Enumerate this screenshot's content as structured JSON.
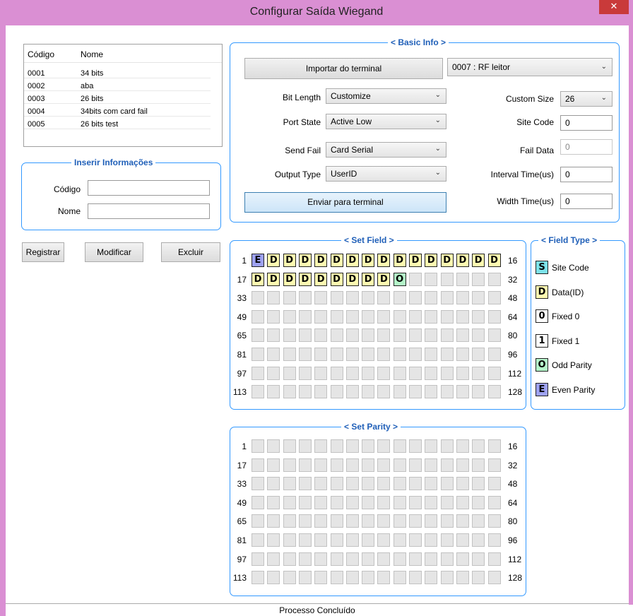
{
  "window": {
    "title": "Configurar Saída Wiegand",
    "close_glyph": "✕"
  },
  "list": {
    "columns": [
      "Código",
      "Nome"
    ],
    "rows": [
      {
        "code": "0001",
        "name": "34 bits"
      },
      {
        "code": "0002",
        "name": "aba"
      },
      {
        "code": "0003",
        "name": "26 bits"
      },
      {
        "code": "0004",
        "name": "34bits com card fail"
      },
      {
        "code": "0005",
        "name": "26 bits test"
      }
    ]
  },
  "inserir": {
    "legend": "Inserir Informações",
    "codigo_label": "Código",
    "nome_label": "Nome",
    "codigo_value": "",
    "nome_value": ""
  },
  "actions": {
    "registrar": "Registrar",
    "modificar": "Modificar",
    "excluir": "Excluir"
  },
  "basic_info": {
    "legend": "< Basic Info >",
    "import_button": "Importar do terminal",
    "terminal_select": "0007 : RF leitor",
    "bit_length_label": "Bit Length",
    "bit_length_value": "Customize",
    "port_state_label": "Port State",
    "port_state_value": "Active Low",
    "send_fail_label": "Send Fail",
    "send_fail_value": "Card Serial",
    "output_type_label": "Output Type",
    "output_type_value": "UserID",
    "custom_size_label": "Custom Size",
    "custom_size_value": "26",
    "site_code_label": "Site Code",
    "site_code_value": "0",
    "fail_data_label": "Fail Data",
    "fail_data_value": "0",
    "interval_label": "Interval Time(us)",
    "interval_value": "0",
    "width_label": "Width Time(us)",
    "width_value": "0",
    "send_button": "Enviar para terminal"
  },
  "set_field": {
    "legend": "< Set Field >",
    "left_numbers": [
      "1",
      "17",
      "33",
      "49",
      "65",
      "81",
      "97",
      "113"
    ],
    "right_numbers": [
      "16",
      "32",
      "48",
      "64",
      "80",
      "96",
      "112",
      "128"
    ],
    "cells": [
      "E",
      "D",
      "D",
      "D",
      "D",
      "D",
      "D",
      "D",
      "D",
      "D",
      "D",
      "D",
      "D",
      "D",
      "D",
      "D",
      "D",
      "D",
      "D",
      "D",
      "D",
      "D",
      "D",
      "D",
      "D",
      "O"
    ]
  },
  "field_type": {
    "legend": "< Field Type >",
    "items": [
      {
        "glyph": "S",
        "label": "Site Code",
        "color": "#7de3ea"
      },
      {
        "glyph": "D",
        "label": "Data(ID)",
        "color": "#fffbb1"
      },
      {
        "glyph": "0",
        "label": "Fixed 0",
        "color": "#ffffff"
      },
      {
        "glyph": "1",
        "label": "Fixed 1",
        "color": "#ffffff"
      },
      {
        "glyph": "O",
        "label": "Odd Parity",
        "color": "#b4f5c9"
      },
      {
        "glyph": "E",
        "label": "Even Parity",
        "color": "#9ea2f2"
      }
    ]
  },
  "set_parity": {
    "legend": "< Set Parity >",
    "left_numbers": [
      "1",
      "17",
      "33",
      "49",
      "65",
      "81",
      "97",
      "113"
    ],
    "right_numbers": [
      "16",
      "32",
      "48",
      "64",
      "80",
      "96",
      "112",
      "128"
    ]
  },
  "status": {
    "text": "Processo Concluído"
  },
  "icons": {
    "chevron": "chevron-down-icon"
  }
}
